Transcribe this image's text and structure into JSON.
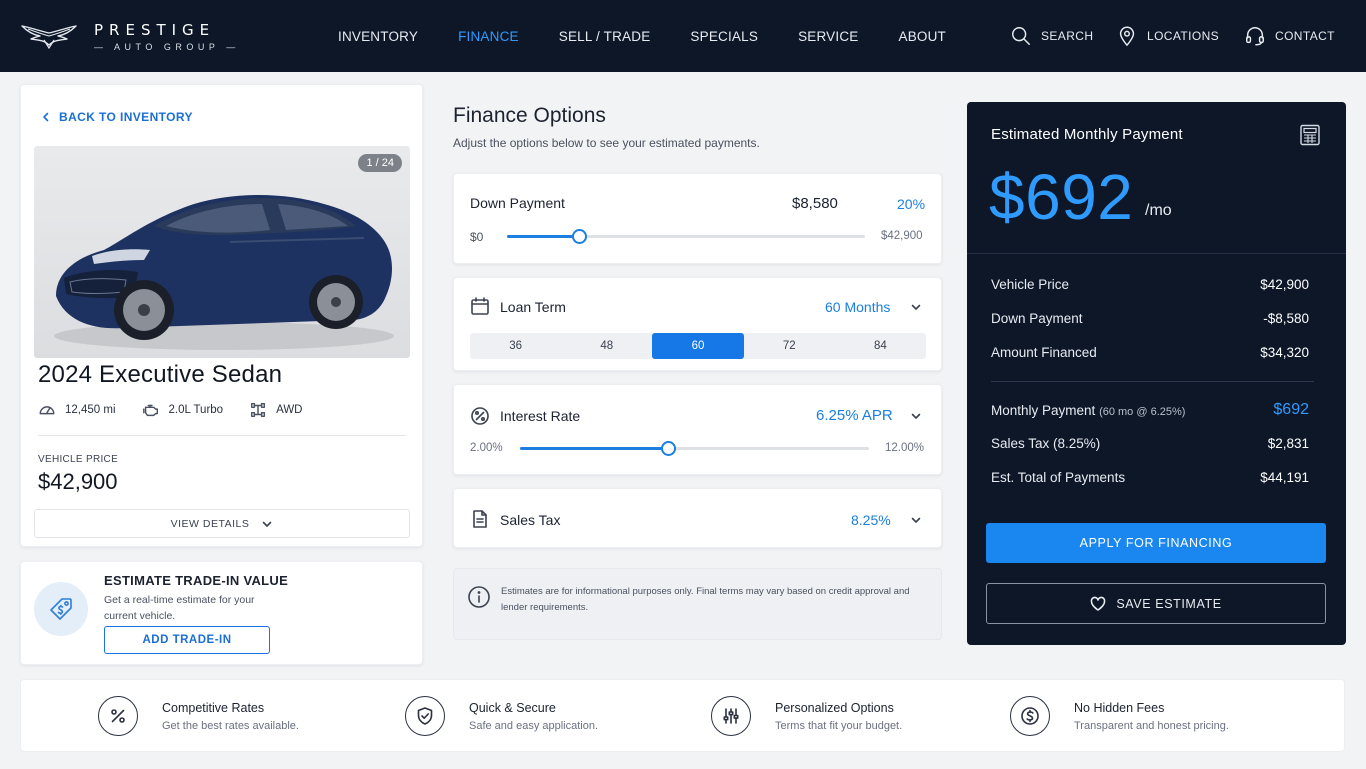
{
  "brand": {
    "name_top": "PRESTIGE",
    "name_bottom": "AUTO GROUP"
  },
  "nav": {
    "items": [
      {
        "label": "INVENTORY",
        "active": false
      },
      {
        "label": "FINANCE",
        "active": true
      },
      {
        "label": "SELL / TRADE",
        "active": false
      },
      {
        "label": "SPECIALS",
        "active": false
      },
      {
        "label": "SERVICE",
        "active": false
      },
      {
        "label": "ABOUT",
        "active": false
      }
    ],
    "search": "SEARCH",
    "locations": "LOCATIONS",
    "contact": "CONTACT"
  },
  "vehicle": {
    "back_label": "BACK TO INVENTORY",
    "photo_count": "1 / 24",
    "title": "2024 Executive Sedan",
    "mileage": "12,450 mi",
    "engine": "2.0L Turbo",
    "drivetrain": "AWD",
    "price_label": "VEHICLE PRICE",
    "price": "$42,900",
    "view_details": "VIEW DETAILS",
    "car_color": "#1e3262"
  },
  "trade_in": {
    "title": "ESTIMATE TRADE-IN VALUE",
    "desc": "Get a real-time estimate for your current vehicle.",
    "button": "ADD TRADE-IN"
  },
  "finance": {
    "title": "Finance Options",
    "subtitle": "Adjust the options below to see your estimated payments.",
    "down_payment": {
      "label": "Down Payment",
      "amount": "$8,580",
      "percent": "20%",
      "min": "$0",
      "max": "$42,900",
      "fraction": 0.2
    },
    "loan_term": {
      "label": "Loan Term",
      "selected": "60 Months",
      "options": [
        "36",
        "48",
        "60",
        "72",
        "84"
      ],
      "active_index": 2
    },
    "interest_rate": {
      "label": "Interest Rate",
      "value": "6.25% APR",
      "min": "2.00%",
      "max": "12.00%",
      "fraction": 0.425
    },
    "sales_tax": {
      "label": "Sales Tax",
      "value": "8.25%"
    },
    "disclaimer": "Estimates are for informational purposes only. Final terms may vary based on credit approval and lender requirements."
  },
  "payment": {
    "title": "Estimated Monthly Payment",
    "amount": "$692",
    "unit": "/mo",
    "rows": [
      {
        "label": "Vehicle Price",
        "value": "$42,900"
      },
      {
        "label": "Down Payment",
        "value": "-$8,580"
      },
      {
        "label": "Amount Financed",
        "value": "$34,320"
      }
    ],
    "monthly_label": "Monthly Payment",
    "monthly_note": "(60 mo @ 6.25%)",
    "monthly_value": "$692",
    "tax_label": "Sales Tax (8.25%)",
    "tax_value": "$2,831",
    "total_label": "Est. Total of Payments",
    "total_value": "$44,191",
    "apply": "APPLY FOR FINANCING",
    "save": "SAVE ESTIMATE"
  },
  "features": [
    {
      "title": "Competitive Rates",
      "desc": "Get the best rates available.",
      "icon": "percent-icon"
    },
    {
      "title": "Quick & Secure",
      "desc": "Safe and easy application.",
      "icon": "shield-check-icon"
    },
    {
      "title": "Personalized Options",
      "desc": "Terms that fit your budget.",
      "icon": "sliders-icon"
    },
    {
      "title": "No Hidden Fees",
      "desc": "Transparent and honest pricing.",
      "icon": "dollar-icon"
    }
  ],
  "colors": {
    "accent": "#1a7fe0",
    "header": "#0d1728",
    "panel": "#0d1728"
  }
}
